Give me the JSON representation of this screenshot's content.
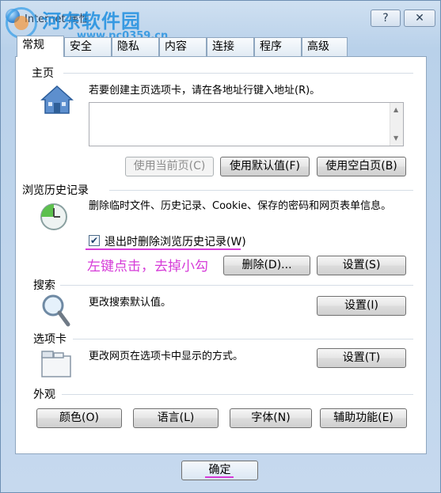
{
  "window": {
    "title": "Internet 属性",
    "help_label": "?",
    "close_label": "✕"
  },
  "watermark": {
    "title": "河东软件园",
    "url": "www.pc0359.cn"
  },
  "tabs": [
    {
      "label": "常规",
      "active": true
    },
    {
      "label": "安全"
    },
    {
      "label": "隐私"
    },
    {
      "label": "内容"
    },
    {
      "label": "连接"
    },
    {
      "label": "程序"
    },
    {
      "label": "高级"
    }
  ],
  "home": {
    "title": "主页",
    "desc": "若要创建主页选项卡，请在各地址行键入地址(R)。",
    "address_value": "",
    "use_current": "使用当前页(C)",
    "use_default": "使用默认值(F)",
    "use_blank": "使用空白页(B)"
  },
  "history": {
    "title": "浏览历史记录",
    "desc": "删除临时文件、历史记录、Cookie、保存的密码和网页表单信息。",
    "checkbox_label": "退出时删除浏览历史记录(W)",
    "checkbox_checked": true,
    "annotation": "左键点击，去掉小勾",
    "delete": "删除(D)...",
    "settings": "设置(S)"
  },
  "search": {
    "title": "搜索",
    "desc": "更改搜索默认值。",
    "settings": "设置(I)"
  },
  "tabsec": {
    "title": "选项卡",
    "desc": "更改网页在选项卡中显示的方式。",
    "settings": "设置(T)"
  },
  "appearance": {
    "title": "外观",
    "colors": "颜色(O)",
    "languages": "语言(L)",
    "fonts": "字体(N)",
    "accessibility": "辅助功能(E)"
  },
  "footer": {
    "ok": "确定"
  },
  "colors": {
    "annotation": "#d63bd8",
    "watermark": "#1e8fe0"
  }
}
